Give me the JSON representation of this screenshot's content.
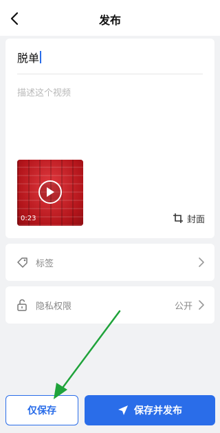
{
  "header": {
    "title": "发布",
    "back_icon": "chevron-left-icon"
  },
  "editor": {
    "title_value": "脱单",
    "description_placeholder": "描述这个视频"
  },
  "video": {
    "duration": "0:23",
    "play_icon": "play-icon"
  },
  "cover": {
    "label": "封面",
    "icon": "crop-icon"
  },
  "tags_row": {
    "label": "标签",
    "icon": "tag-icon"
  },
  "privacy_row": {
    "label": "隐私权限",
    "value": "公开",
    "icon": "lock-open-icon"
  },
  "actions": {
    "save_only_label": "仅保存",
    "save_publish_label": "保存并发布",
    "send_icon": "send-icon"
  },
  "colors": {
    "accent": "#2a6de9",
    "annotation_arrow": "#1fa33a"
  }
}
